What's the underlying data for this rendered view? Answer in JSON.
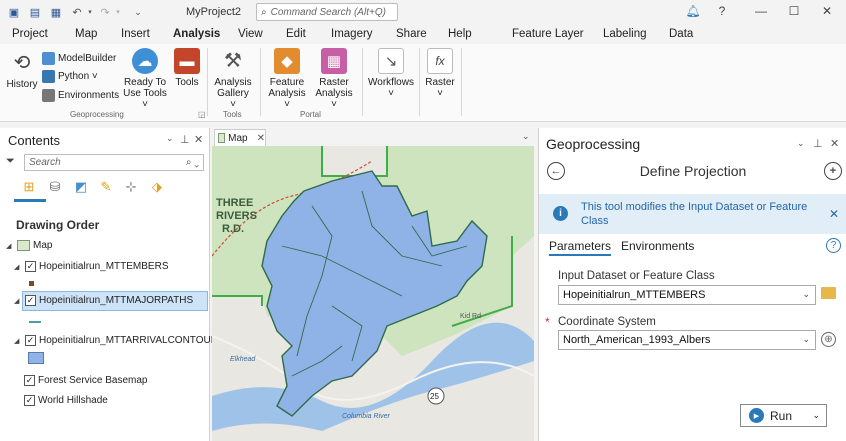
{
  "titlebar": {
    "project_name": "MyProject2",
    "command_search_placeholder": "Command Search (Alt+Q)"
  },
  "ribbon_tabs": [
    "Project",
    "Map",
    "Insert",
    "Analysis",
    "View",
    "Edit",
    "Imagery",
    "Share",
    "Help"
  ],
  "active_tab": "Analysis",
  "contextual_tabs": [
    "Feature Layer",
    "Labeling",
    "Data"
  ],
  "ribbon": {
    "history": "History",
    "modelbuilder": "ModelBuilder",
    "python": "Python ˅",
    "environments": "Environments",
    "ready_to_use_line1": "Ready To",
    "ready_to_use_line2": "Use Tools ˅",
    "tools": "Tools",
    "analysis_gallery_line1": "Analysis",
    "analysis_gallery_line2": "Gallery ˅",
    "feature_analysis_line1": "Feature",
    "feature_analysis_line2": "Analysis ˅",
    "raster_analysis_line1": "Raster",
    "raster_analysis_line2": "Analysis ˅",
    "workflows": "Workflows",
    "workflows_caret": "˅",
    "raster": "Raster",
    "raster_caret": "˅",
    "group_geoprocessing": "Geoprocessing",
    "group_tools": "Tools",
    "group_portal": "Portal",
    "raster_fx_icon": "fx"
  },
  "contents": {
    "title": "Contents",
    "search_placeholder": "Search",
    "drawing_order": "Drawing Order",
    "map_name": "Map",
    "layers": [
      {
        "name": "Hopeinitialrun_MTTEMBERS"
      },
      {
        "name": "Hopeinitialrun_MTTMAJORPATHS"
      },
      {
        "name": "Hopeinitialrun_MTTARRIVALCONTOUR"
      },
      {
        "name": "Forest Service Basemap"
      },
      {
        "name": "World Hillshade"
      }
    ]
  },
  "map_view": {
    "tab_label": "Map",
    "area_label_line1": "THREE",
    "area_label_line2": "RIVERS",
    "area_label_line3": "R.D.",
    "road_label": "25",
    "place_labels": [
      "Kid Rd",
      "Columbia River",
      "Elkhead"
    ]
  },
  "geoprocessing": {
    "title": "Geoprocessing",
    "tool_title": "Define Projection",
    "info_message": "This tool modifies the Input Dataset or Feature Class",
    "tab_parameters": "Parameters",
    "tab_environments": "Environments",
    "input_label": "Input Dataset or Feature Class",
    "input_value": "Hopeinitialrun_MTTEMBERS",
    "required_marker": "*",
    "coord_label": "Coordinate System",
    "coord_value": "North_American_1993_Albers",
    "run_label": "Run"
  },
  "colors": {
    "accent": "#2a7ab8",
    "polygon_fill": "#8fb3e6",
    "polygon_stroke": "#2f6b4a",
    "forest_green": "#c3e3b1",
    "boundary_green": "#3fae49",
    "river": "#9fc3e8"
  }
}
